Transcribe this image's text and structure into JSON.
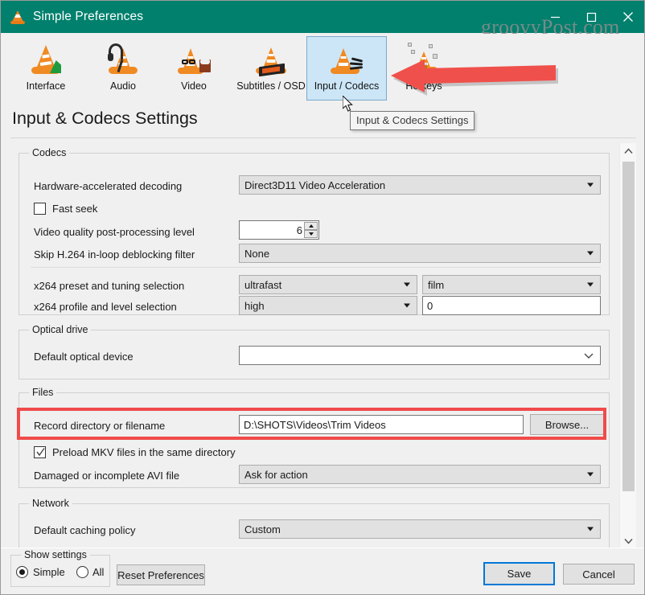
{
  "window": {
    "title": "Simple Preferences",
    "app_icon": "vlc-cone-icon",
    "minimize_label": "Minimize",
    "maximize_label": "Maximize",
    "close_label": "Close",
    "titlebar_color": "#00806d"
  },
  "watermark": {
    "text": "groovyPost.com"
  },
  "toolbar": {
    "items": [
      {
        "id": "interface",
        "label": "Interface",
        "icon": "vlc-interface-icon",
        "selected": false
      },
      {
        "id": "audio",
        "label": "Audio",
        "icon": "vlc-audio-icon",
        "selected": false
      },
      {
        "id": "video",
        "label": "Video",
        "icon": "vlc-video-icon",
        "selected": false
      },
      {
        "id": "subtitles",
        "label": "Subtitles / OSD",
        "icon": "vlc-subtitles-icon",
        "selected": false
      },
      {
        "id": "input-codecs",
        "label": "Input / Codecs",
        "icon": "vlc-input-codecs-icon",
        "selected": true
      },
      {
        "id": "hotkeys",
        "label": "Hotkeys",
        "icon": "vlc-hotkeys-icon",
        "selected": false
      }
    ]
  },
  "page": {
    "title": "Input & Codecs Settings",
    "tooltip": "Input & Codecs Settings"
  },
  "sections": {
    "codecs": {
      "legend": "Codecs",
      "hw_decoding": {
        "label": "Hardware-accelerated decoding",
        "value": "Direct3D11 Video Acceleration"
      },
      "fast_seek": {
        "label": "Fast seek",
        "checked": false
      },
      "postproc": {
        "label": "Video quality post-processing level",
        "value": "6"
      },
      "skip_deblock": {
        "label": "Skip H.264 in-loop deblocking filter",
        "value": "None"
      },
      "x264_preset": {
        "label": "x264 preset and tuning selection",
        "preset": "ultrafast",
        "tuning": "film"
      },
      "x264_profile": {
        "label": "x264 profile and level selection",
        "profile": "high",
        "level": "0"
      }
    },
    "optical": {
      "legend": "Optical drive",
      "default_device": {
        "label": "Default optical device",
        "value": ""
      }
    },
    "files": {
      "legend": "Files",
      "record_dir": {
        "label": "Record directory or filename",
        "value": "D:\\SHOTS\\Videos\\Trim Videos",
        "browse_label": "Browse...",
        "highlight_color": "#f04b4b"
      },
      "preload_mkv": {
        "label": "Preload MKV files in the same directory",
        "checked": true
      },
      "damaged_avi": {
        "label": "Damaged or incomplete AVI file",
        "value": "Ask for action"
      }
    },
    "network": {
      "legend": "Network",
      "caching_policy": {
        "label": "Default caching policy",
        "value": "Custom"
      }
    }
  },
  "footer": {
    "show_settings_legend": "Show settings",
    "radio_simple": "Simple",
    "radio_all": "All",
    "simple_selected": true,
    "reset_label": "Reset Preferences",
    "save_label": "Save",
    "cancel_label": "Cancel"
  },
  "annotation": {
    "arrow_color": "#f0504b"
  },
  "scrollbar": {
    "up_label": "Scroll up",
    "down_label": "Scroll down"
  }
}
